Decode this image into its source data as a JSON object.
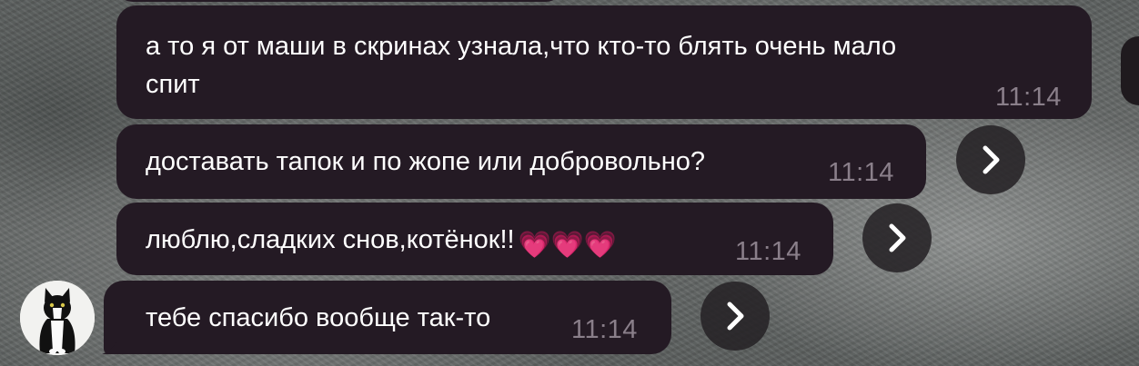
{
  "messages": [
    {
      "line1": "а то я от маши в скринах узнала,что кто-то блять очень мало",
      "line2": "спит",
      "time": "11:14"
    },
    {
      "text": "доставать тапок и по жопе или добровольно?",
      "time": "11:14"
    },
    {
      "text": "люблю,сладких снов,котёнок!!",
      "emoji": "💗💗💗",
      "time": "11:14"
    },
    {
      "text": "тебе спасибо вообще так-то",
      "time": "11:14"
    }
  ],
  "icons": {
    "forward": "chevron-right-icon",
    "avatar": "cat-avatar"
  },
  "colors": {
    "bubble": "#241a24",
    "time": "#8a7f8a",
    "text": "#ffffff"
  }
}
